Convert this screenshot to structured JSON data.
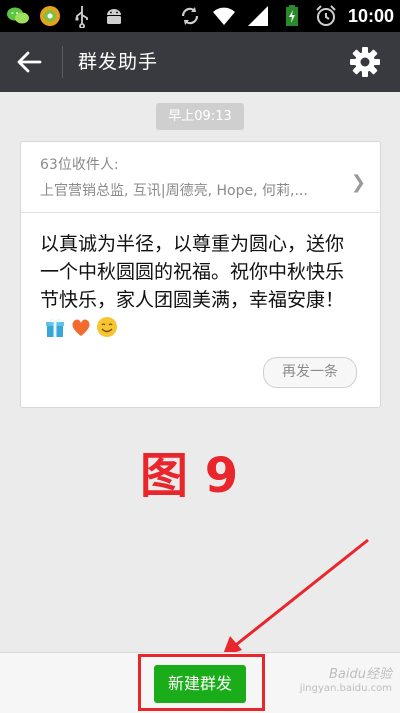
{
  "status_bar": {
    "time": "10:00",
    "left_icons": [
      "wechat-icon",
      "game-icon",
      "usb-icon",
      "android-icon"
    ],
    "right_icons": [
      "sync-icon",
      "wifi-icon",
      "signal-icon",
      "battery-icon",
      "alarm-icon"
    ]
  },
  "header": {
    "title": "群发助手",
    "back_icon": "arrow-left-icon",
    "settings_icon": "gear-icon"
  },
  "chat": {
    "timestamp": "早上09:13",
    "card": {
      "recipient_count": "63位收件人:",
      "recipient_names": "上官营销总监, 互讯|周德亮, Hope, 何莉,...",
      "message": "以真诚为半径，以尊重为圆心，送你一个中秋圆圆的祝福。祝你中秋快乐节快乐，家人团圆美满，幸福安康！",
      "emojis": [
        "gift-icon",
        "heart-icon",
        "smile-icon"
      ],
      "resend_label": "再发一条"
    }
  },
  "annotation": {
    "label": "图 9",
    "color": "#e8262b"
  },
  "bottom": {
    "new_broadcast_label": "新建群发",
    "button_color": "#1aad19"
  },
  "watermark": {
    "line1": "Baidu经验",
    "line2": "jingyan.baidu.com"
  }
}
